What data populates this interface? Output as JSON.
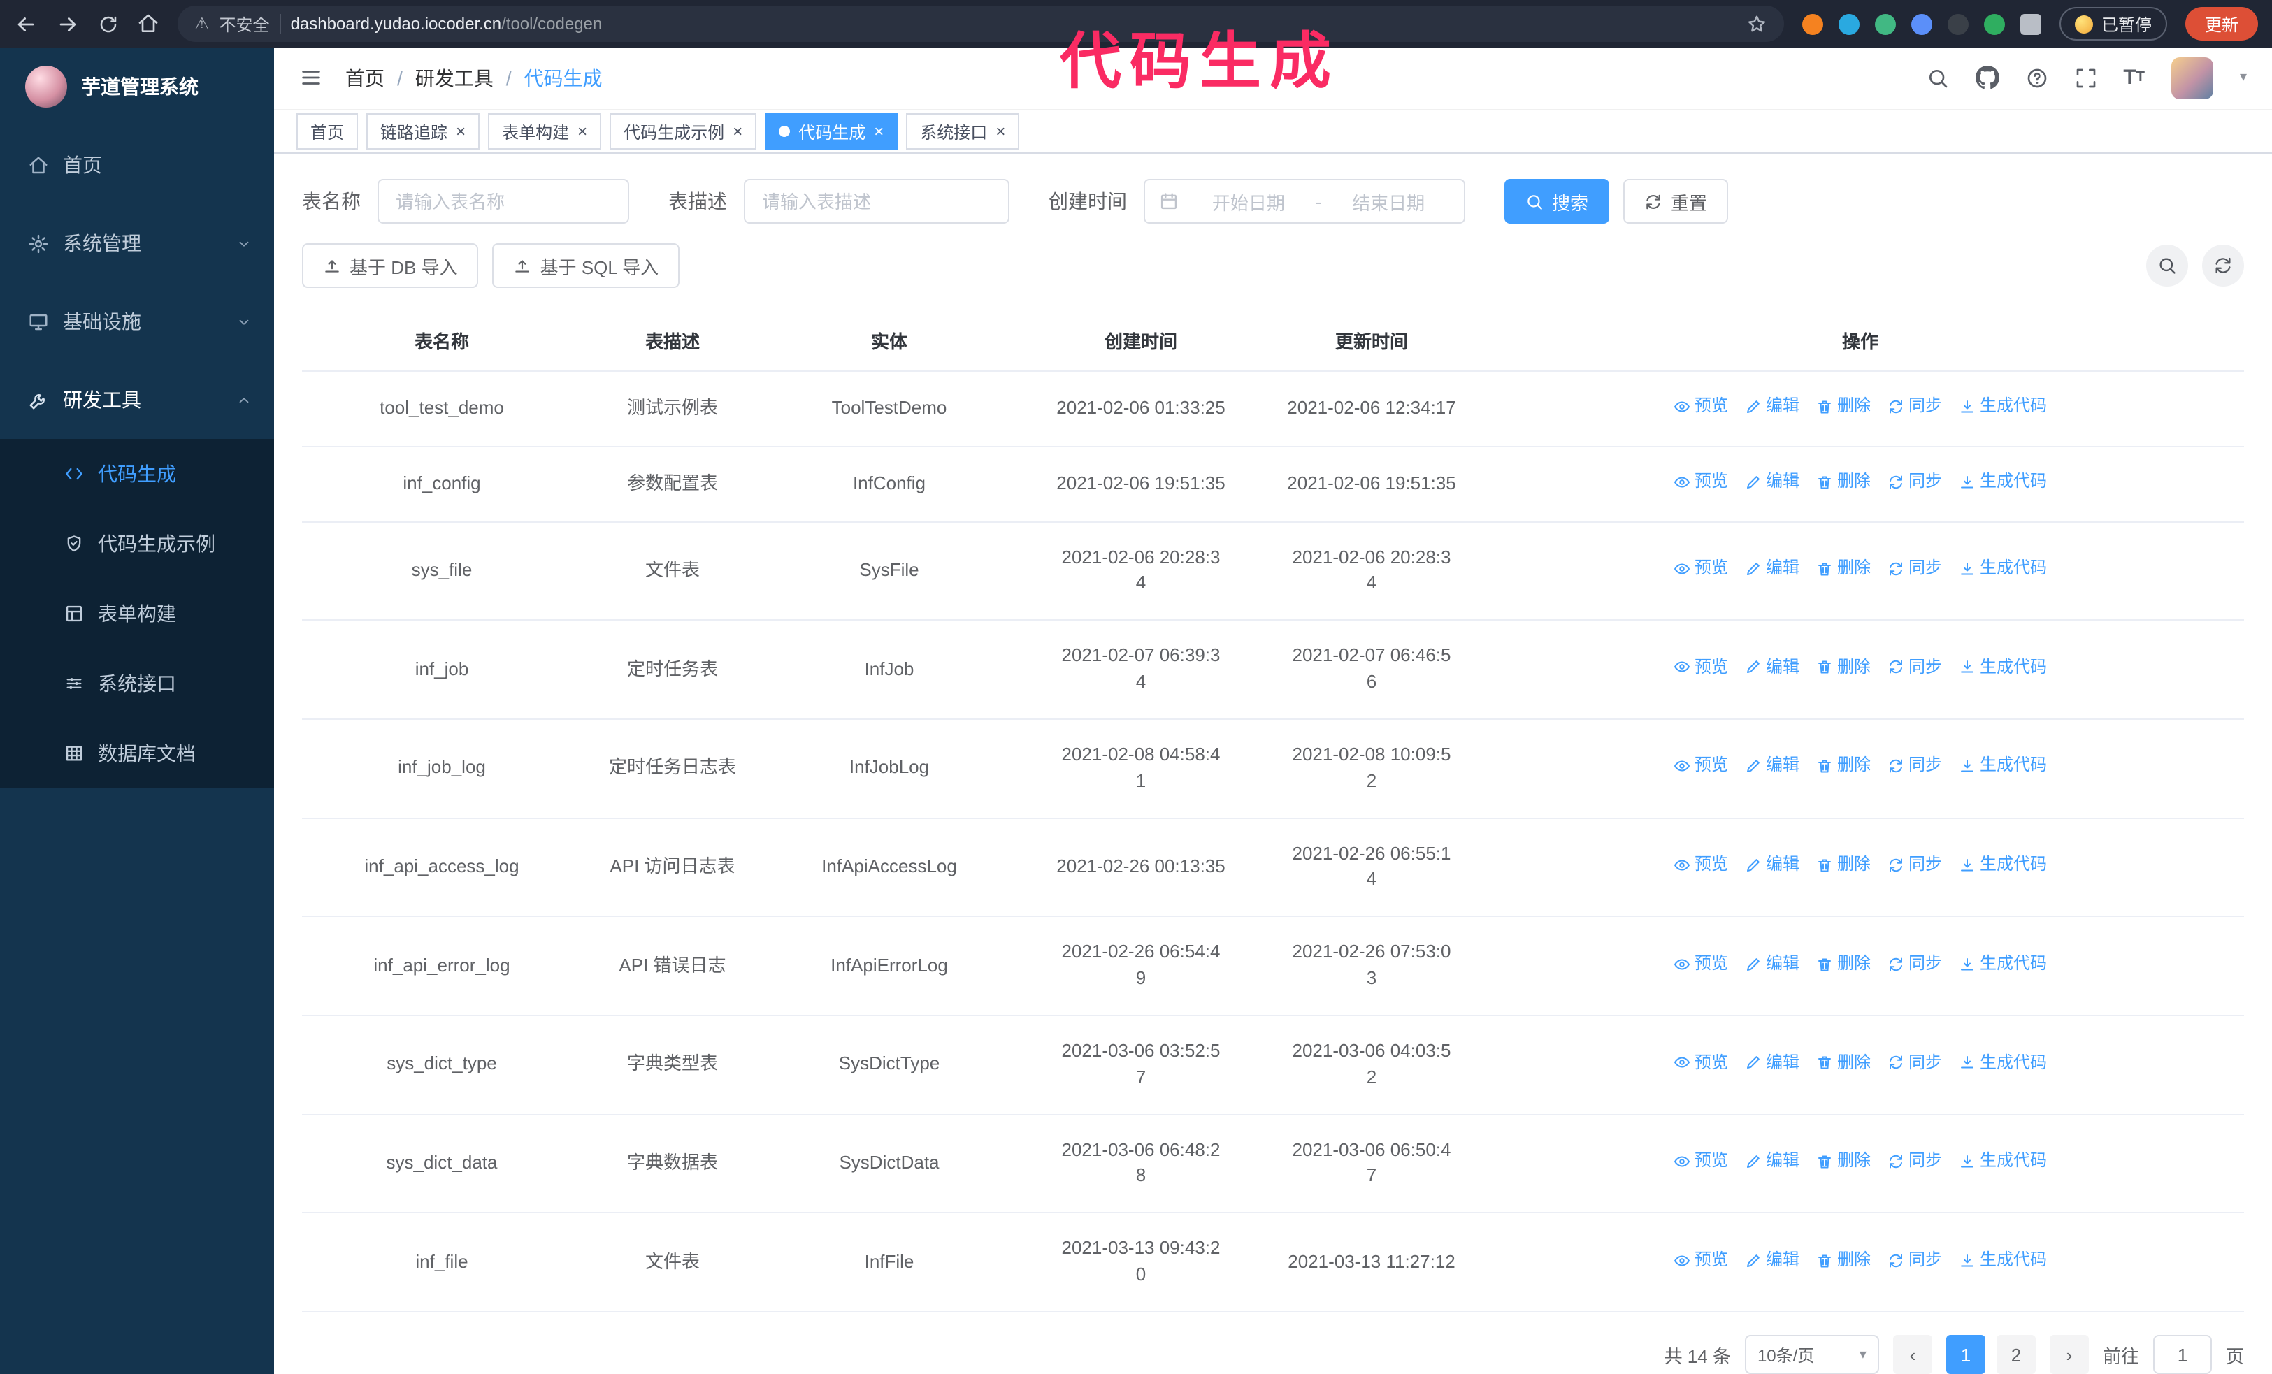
{
  "annotation": {
    "text": "代码生成",
    "color": "#fa2b63"
  },
  "browser": {
    "security_label": "不安全",
    "url_host": "dashboard.yudao.iocoder.cn",
    "url_path": "/tool/codegen",
    "paused_badge": "已暂停",
    "update_button": "更新",
    "extensions": [
      {
        "id": "proxy",
        "name": "orange-extension-icon",
        "color": "#f58220"
      },
      {
        "id": "drop",
        "name": "blue-drop-extension-icon",
        "color": "#2aa9e0"
      },
      {
        "id": "vue",
        "name": "vue-devtools-extension-icon",
        "color": "#41b883"
      },
      {
        "id": "users",
        "name": "users-extension-icon",
        "color": "#5b8ff9"
      },
      {
        "id": "dark",
        "name": "dark-extension-icon",
        "color": "#3a4048"
      },
      {
        "id": "leaf",
        "name": "green-leaf-extension-icon",
        "color": "#2fae60"
      },
      {
        "id": "puzzle",
        "name": "puzzle-extension-icon",
        "color": "#b9bec6"
      }
    ]
  },
  "sidebar": {
    "logo_title": "芋道管理系统",
    "menu": [
      {
        "id": "home",
        "label": "首页",
        "icon": "home-icon"
      },
      {
        "id": "system",
        "label": "系统管理",
        "icon": "gear-icon",
        "collapsed": true
      },
      {
        "id": "infra",
        "label": "基础设施",
        "icon": "monitor-icon",
        "collapsed": true
      },
      {
        "id": "devtools",
        "label": "研发工具",
        "icon": "tools-icon",
        "open": true,
        "children": [
          {
            "id": "codegen",
            "label": "代码生成",
            "icon": "code-icon",
            "active": true
          },
          {
            "id": "codegen-example",
            "label": "代码生成示例",
            "icon": "shield-check-icon"
          },
          {
            "id": "form-builder",
            "label": "表单构建",
            "icon": "form-grid-icon"
          },
          {
            "id": "system-api",
            "label": "系统接口",
            "icon": "sliders-icon"
          },
          {
            "id": "db-doc",
            "label": "数据库文档",
            "icon": "database-table-icon"
          }
        ]
      }
    ]
  },
  "header": {
    "breadcrumb": [
      "首页",
      "研发工具",
      "代码生成"
    ]
  },
  "tabs": [
    {
      "id": "home",
      "label": "首页",
      "closable": false,
      "active": false
    },
    {
      "id": "trace",
      "label": "链路追踪",
      "closable": true,
      "active": false
    },
    {
      "id": "form-builder",
      "label": "表单构建",
      "closable": true,
      "active": false
    },
    {
      "id": "codegen-example",
      "label": "代码生成示例",
      "closable": true,
      "active": false
    },
    {
      "id": "codegen",
      "label": "代码生成",
      "closable": true,
      "active": true
    },
    {
      "id": "system-api",
      "label": "系统接口",
      "closable": true,
      "active": false
    }
  ],
  "filters": {
    "table_name_label": "表名称",
    "table_name_placeholder": "请输入表名称",
    "table_desc_label": "表描述",
    "table_desc_placeholder": "请输入表描述",
    "create_time_label": "创建时间",
    "date_start_placeholder": "开始日期",
    "date_separator": "-",
    "date_end_placeholder": "结束日期",
    "search_button": "搜索",
    "reset_button": "重置"
  },
  "toolbar": {
    "import_db_button": "基于 DB 导入",
    "import_sql_button": "基于 SQL 导入"
  },
  "table": {
    "columns": [
      "表名称",
      "表描述",
      "实体",
      "创建时间",
      "更新时间",
      "操作"
    ],
    "op_labels": [
      {
        "id": "preview-link",
        "label": "预览",
        "icon": "eye-icon"
      },
      {
        "id": "edit-link",
        "label": "编辑",
        "icon": "pencil-icon"
      },
      {
        "id": "delete-link",
        "label": "删除",
        "icon": "trash-icon"
      },
      {
        "id": "sync-link",
        "label": "同步",
        "icon": "sync-icon"
      },
      {
        "id": "generate-link",
        "label": "生成代码",
        "icon": "download-icon"
      }
    ],
    "rows": [
      {
        "name": "tool_test_demo",
        "desc": "测试示例表",
        "entity": "ToolTestDemo",
        "create_time": "2021-02-06 01:33:25",
        "update_time": "2021-02-06 12:34:17"
      },
      {
        "name": "inf_config",
        "desc": "参数配置表",
        "entity": "InfConfig",
        "create_time": "2021-02-06 19:51:35",
        "update_time": "2021-02-06 19:51:35"
      },
      {
        "name": "sys_file",
        "desc": "文件表",
        "entity": "SysFile",
        "create_time": "2021-02-06 20:28:3\n4",
        "update_time": "2021-02-06 20:28:3\n4"
      },
      {
        "name": "inf_job",
        "desc": "定时任务表",
        "entity": "InfJob",
        "create_time": "2021-02-07 06:39:3\n4",
        "update_time": "2021-02-07 06:46:5\n6"
      },
      {
        "name": "inf_job_log",
        "desc": "定时任务日志表",
        "entity": "InfJobLog",
        "create_time": "2021-02-08 04:58:4\n1",
        "update_time": "2021-02-08 10:09:5\n2"
      },
      {
        "name": "inf_api_access_log",
        "desc": "API 访问日志表",
        "entity": "InfApiAccessLog",
        "create_time": "2021-02-26 00:13:35",
        "update_time": "2021-02-26 06:55:1\n4"
      },
      {
        "name": "inf_api_error_log",
        "desc": "API 错误日志",
        "entity": "InfApiErrorLog",
        "create_time": "2021-02-26 06:54:4\n9",
        "update_time": "2021-02-26 07:53:0\n3"
      },
      {
        "name": "sys_dict_type",
        "desc": "字典类型表",
        "entity": "SysDictType",
        "create_time": "2021-03-06 03:52:5\n7",
        "update_time": "2021-03-06 04:03:5\n2"
      },
      {
        "name": "sys_dict_data",
        "desc": "字典数据表",
        "entity": "SysDictData",
        "create_time": "2021-03-06 06:48:2\n8",
        "update_time": "2021-03-06 06:50:4\n7"
      },
      {
        "name": "inf_file",
        "desc": "文件表",
        "entity": "InfFile",
        "create_time": "2021-03-13 09:43:2\n0",
        "update_time": "2021-03-13 11:27:12"
      }
    ]
  },
  "pagination": {
    "total_text": "共 14 条",
    "page_size": "10条/页",
    "pages": [
      "1",
      "2"
    ],
    "active_page": "1",
    "goto_label": "前往",
    "goto_value": "1",
    "goto_suffix": "页"
  }
}
